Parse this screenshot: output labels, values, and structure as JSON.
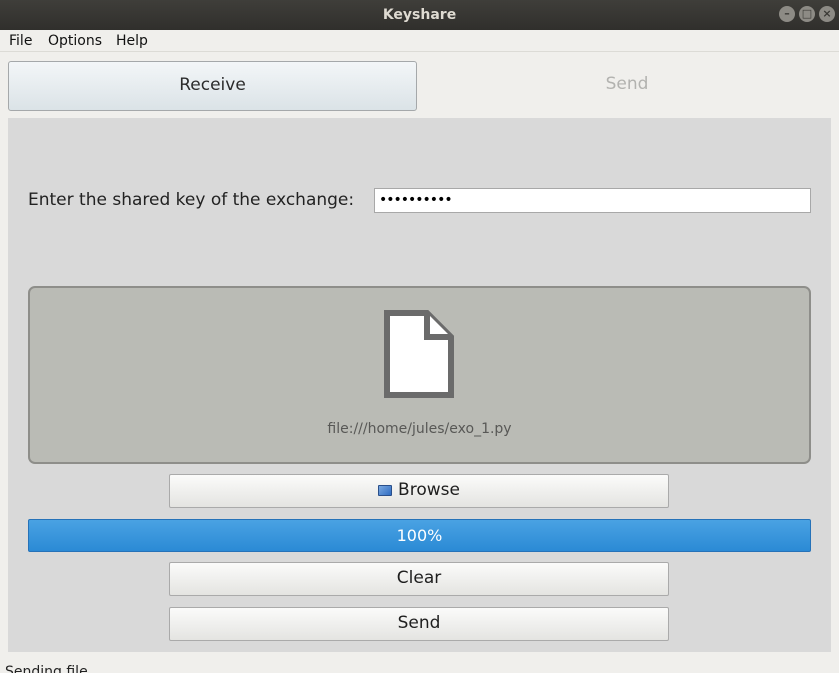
{
  "window": {
    "title": "Keyshare",
    "controls": [
      "–",
      "□",
      "×"
    ]
  },
  "menu": {
    "file": "File",
    "options": "Options",
    "help": "Help"
  },
  "tabs": {
    "receive": "Receive",
    "send": "Send"
  },
  "key": {
    "label": "Enter the shared key of the exchange:",
    "value": "••••••••••"
  },
  "dropzone": {
    "icon": "file-icon",
    "path": "file:///home/jules/exo_1.py"
  },
  "buttons": {
    "browse": "Browse",
    "clear": "Clear",
    "send": "Send"
  },
  "progress": {
    "value": 100,
    "label": "100%"
  },
  "status": {
    "text": "Sending file..."
  },
  "colors": {
    "progress": "#3396dc",
    "dropzone": "#babbb5",
    "panel": "#d9d9d9"
  }
}
